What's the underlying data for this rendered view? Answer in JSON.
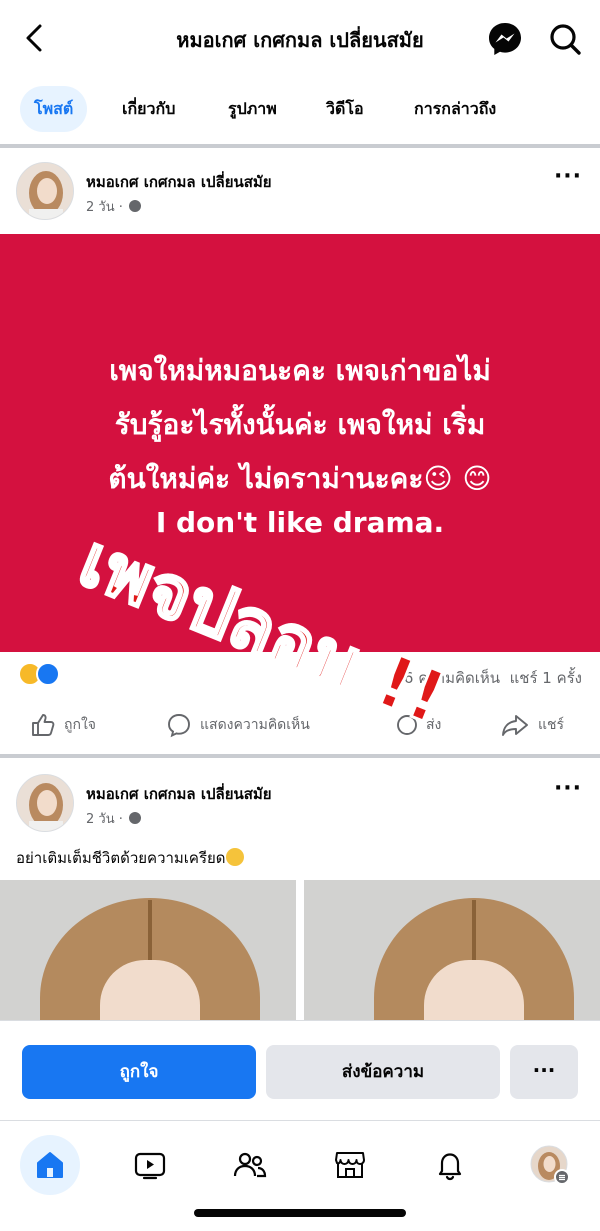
{
  "header": {
    "title": "หมอเกศ  เกศกมล เปลี่ยนสมัย",
    "back_icon": "chevron-left-icon",
    "messenger_icon": "messenger-icon",
    "search_icon": "search-icon"
  },
  "tabs": [
    {
      "label": "โพสต์",
      "active": true
    },
    {
      "label": "เกี่ยวกับ"
    },
    {
      "label": "รูปภาพ"
    },
    {
      "label": "วิดีโอ"
    },
    {
      "label": "การกล่าวถึง"
    }
  ],
  "posts": [
    {
      "author": "หมอเกศ  เกศกมล เปลี่ยนสมัย",
      "time": "2 วัน ·",
      "banner_lines": [
        "เพจใหม่หมอนะคะ เพจเก่าขอไม่",
        "รับรู้อะไรทั้งนั้นค่ะ เพจใหม่ เริ่ม",
        "ต้นใหม่ค่ะ ไม่ดราม่านะคะ😉 😊"
      ],
      "banner_en": "I don't like drama.",
      "banner_color": "#d4113f",
      "reactions": [
        "haha",
        "like"
      ],
      "comments_count": "6 ความคิดเห็น",
      "shares_count": "แชร์ 1 ครั้ง",
      "actions": {
        "like": "ถูกใจ",
        "comment": "แสดงความคิดเห็น",
        "send": "ส่ง",
        "share": "แชร์"
      }
    },
    {
      "author": "หมอเกศ  เกศกมล เปลี่ยนสมัย",
      "time": "2 วัน ·",
      "caption": "อย่าเติมเต็มชีวิตด้วยความเครียด"
    }
  ],
  "watermark": "เพจปลอม !!",
  "page_actions": {
    "like": "ถูกใจ",
    "message": "ส่งข้อความ",
    "more": "···"
  },
  "nav": [
    {
      "icon": "home-icon",
      "active": true
    },
    {
      "icon": "video-icon"
    },
    {
      "icon": "friends-icon"
    },
    {
      "icon": "marketplace-icon"
    },
    {
      "icon": "bell-icon"
    },
    {
      "icon": "profile-avatar-icon"
    }
  ],
  "colors": {
    "accent": "#1877f2",
    "banner": "#d4113f",
    "watermark": "#e01818"
  }
}
